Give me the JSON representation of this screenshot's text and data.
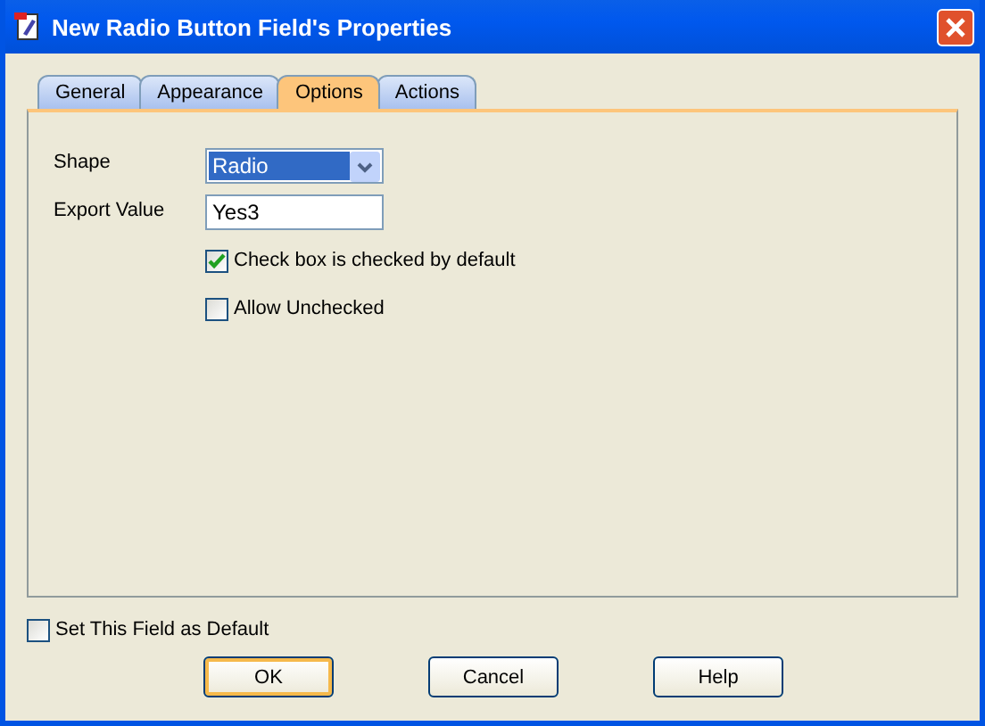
{
  "window": {
    "title": "New Radio Button Field's Properties"
  },
  "tabs": [
    {
      "label": "General",
      "selected": false
    },
    {
      "label": "Appearance",
      "selected": false
    },
    {
      "label": "Options",
      "selected": true
    },
    {
      "label": "Actions",
      "selected": false
    }
  ],
  "shape": {
    "label": "Shape",
    "value": "Radio"
  },
  "export_value": {
    "label": "Export Value",
    "value": "Yes3"
  },
  "options": [
    {
      "label": "Check box is checked by default",
      "checked": true
    },
    {
      "label": "Allow Unchecked",
      "checked": false
    }
  ],
  "set_default": {
    "label": "Set This Field as Default",
    "checked": false
  },
  "buttons": [
    {
      "label": "OK",
      "default": true
    },
    {
      "label": "Cancel",
      "default": false
    },
    {
      "label": "Help",
      "default": false
    }
  ]
}
